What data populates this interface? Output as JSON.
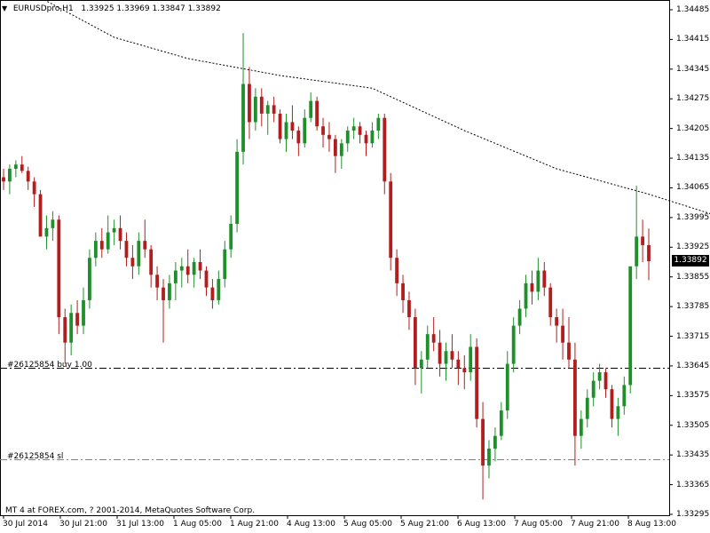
{
  "header": {
    "symbol": "EURUSDpro,H1",
    "ohlc": "1.33925 1.33969 1.33847 1.33892"
  },
  "current_price": "1.33892",
  "orders": {
    "buy_label": "#26125854 buy 1.00",
    "sl_label": "#26125854 sl"
  },
  "copyright": "MT 4 at FOREX.com, ? 2001-2014, MetaQuotes Software Corp.",
  "colors": {
    "bull": "#1f8f2a",
    "bear": "#b21e1e",
    "ma_line": "#000000",
    "buy_line": "#000000",
    "sl_line": "#e0603a",
    "background": "#ffffff",
    "current_price_bg": "#000000"
  },
  "chart_data": {
    "type": "candlestick",
    "title": "EURUSDpro,H1",
    "price_ticks": [
      "1.34485",
      "1.34415",
      "1.34345",
      "1.34275",
      "1.34205",
      "1.34135",
      "1.34065",
      "1.33995",
      "1.33925",
      "1.33855",
      "1.33785",
      "1.33715",
      "1.33645",
      "1.33575",
      "1.33505",
      "1.33435",
      "1.33365",
      "1.33295"
    ],
    "time_ticks": [
      "30 Jul 2014",
      "30 Jul 21:00",
      "31 Jul 13:00",
      "1 Aug 05:00",
      "1 Aug 21:00",
      "4 Aug 13:00",
      "5 Aug 05:00",
      "5 Aug 21:00",
      "6 Aug 13:00",
      "7 Aug 05:00",
      "7 Aug 21:00",
      "8 Aug 13:00"
    ],
    "ylim": [
      1.33295,
      1.34485
    ],
    "buy_level": 1.3364,
    "sl_level": 1.33425,
    "moving_average": [
      [
        0,
        1.3456
      ],
      [
        18,
        1.3442
      ],
      [
        30,
        1.3437
      ],
      [
        45,
        1.3433
      ],
      [
        60,
        1.343
      ],
      [
        75,
        1.342
      ],
      [
        90,
        1.3411
      ],
      [
        105,
        1.3405
      ],
      [
        117,
        1.33995
      ],
      [
        120,
        1.3398
      ]
    ],
    "candles": [
      [
        1.3409,
        1.3411,
        1.3406,
        1.3408
      ],
      [
        1.3408,
        1.3412,
        1.3405,
        1.3411
      ],
      [
        1.3411,
        1.3413,
        1.3409,
        1.3412
      ],
      [
        1.3412,
        1.3414,
        1.341,
        1.34105
      ],
      [
        1.34105,
        1.34115,
        1.3406,
        1.3408
      ],
      [
        1.3408,
        1.3409,
        1.3402,
        1.3405
      ],
      [
        1.3405,
        1.3406,
        1.3398,
        1.3395
      ],
      [
        1.3395,
        1.34,
        1.3392,
        1.3397
      ],
      [
        1.3397,
        1.3401,
        1.3394,
        1.3399
      ],
      [
        1.3399,
        1.34,
        1.3372,
        1.3376
      ],
      [
        1.3376,
        1.3378,
        1.3365,
        1.337
      ],
      [
        1.337,
        1.3379,
        1.3367,
        1.3377
      ],
      [
        1.3377,
        1.338,
        1.3372,
        1.3374
      ],
      [
        1.3374,
        1.3383,
        1.3372,
        1.338
      ],
      [
        1.338,
        1.3392,
        1.3378,
        1.339
      ],
      [
        1.339,
        1.3396,
        1.3388,
        1.3394
      ],
      [
        1.3394,
        1.3397,
        1.339,
        1.3392
      ],
      [
        1.3392,
        1.34,
        1.3391,
        1.3396
      ],
      [
        1.3396,
        1.3399,
        1.3393,
        1.3397
      ],
      [
        1.3397,
        1.34,
        1.3392,
        1.3394
      ],
      [
        1.3394,
        1.3396,
        1.3388,
        1.339
      ],
      [
        1.339,
        1.3393,
        1.3385,
        1.3388
      ],
      [
        1.3388,
        1.3396,
        1.3386,
        1.3394
      ],
      [
        1.3394,
        1.3399,
        1.339,
        1.3392
      ],
      [
        1.3392,
        1.3393,
        1.3383,
        1.3386
      ],
      [
        1.3386,
        1.3388,
        1.338,
        1.3383
      ],
      [
        1.3383,
        1.3385,
        1.337,
        1.338
      ],
      [
        1.338,
        1.3386,
        1.3378,
        1.3384
      ],
      [
        1.3384,
        1.3389,
        1.338,
        1.3387
      ],
      [
        1.3387,
        1.339,
        1.3383,
        1.3388
      ],
      [
        1.3388,
        1.3392,
        1.3384,
        1.3386
      ],
      [
        1.3386,
        1.339,
        1.3383,
        1.3389
      ],
      [
        1.3389,
        1.3392,
        1.3385,
        1.3387
      ],
      [
        1.3387,
        1.3388,
        1.3381,
        1.3383
      ],
      [
        1.3383,
        1.3385,
        1.3378,
        1.338
      ],
      [
        1.338,
        1.3387,
        1.3379,
        1.3385
      ],
      [
        1.3385,
        1.3394,
        1.3383,
        1.3392
      ],
      [
        1.3392,
        1.34,
        1.339,
        1.3398
      ],
      [
        1.3398,
        1.3418,
        1.3396,
        1.3415
      ],
      [
        1.3415,
        1.3443,
        1.3412,
        1.3431
      ],
      [
        1.3431,
        1.3435,
        1.3418,
        1.3422
      ],
      [
        1.3422,
        1.343,
        1.342,
        1.3428
      ],
      [
        1.3428,
        1.343,
        1.3421,
        1.3424
      ],
      [
        1.3424,
        1.3427,
        1.3419,
        1.3426
      ],
      [
        1.3426,
        1.3428,
        1.3422,
        1.3424
      ],
      [
        1.3424,
        1.3425,
        1.3417,
        1.3418
      ],
      [
        1.3418,
        1.3424,
        1.3415,
        1.3422
      ],
      [
        1.3422,
        1.3426,
        1.3418,
        1.342
      ],
      [
        1.342,
        1.3421,
        1.3414,
        1.3417
      ],
      [
        1.3417,
        1.3425,
        1.3416,
        1.3423
      ],
      [
        1.3423,
        1.3429,
        1.3422,
        1.3427
      ],
      [
        1.3427,
        1.3428,
        1.342,
        1.3421
      ],
      [
        1.3421,
        1.3423,
        1.3416,
        1.3419
      ],
      [
        1.3419,
        1.3422,
        1.3415,
        1.3418
      ],
      [
        1.3418,
        1.3419,
        1.341,
        1.3414
      ],
      [
        1.3414,
        1.3418,
        1.3411,
        1.3417
      ],
      [
        1.3417,
        1.3421,
        1.3415,
        1.342
      ],
      [
        1.342,
        1.3423,
        1.3418,
        1.3421
      ],
      [
        1.3421,
        1.3422,
        1.3417,
        1.3419
      ],
      [
        1.3419,
        1.342,
        1.3414,
        1.3417
      ],
      [
        1.3417,
        1.3422,
        1.3416,
        1.342
      ],
      [
        1.342,
        1.3424,
        1.3418,
        1.3423
      ],
      [
        1.3423,
        1.3424,
        1.3405,
        1.3408
      ],
      [
        1.3408,
        1.341,
        1.3387,
        1.339
      ],
      [
        1.339,
        1.3392,
        1.3381,
        1.3384
      ],
      [
        1.3384,
        1.3386,
        1.3377,
        1.338
      ],
      [
        1.338,
        1.3382,
        1.3373,
        1.3376
      ],
      [
        1.3376,
        1.3378,
        1.336,
        1.3364
      ],
      [
        1.3364,
        1.3368,
        1.3358,
        1.3366
      ],
      [
        1.3366,
        1.3374,
        1.3364,
        1.3372
      ],
      [
        1.3372,
        1.3376,
        1.3368,
        1.337
      ],
      [
        1.337,
        1.3373,
        1.3362,
        1.3365
      ],
      [
        1.3365,
        1.337,
        1.3361,
        1.3368
      ],
      [
        1.3368,
        1.3372,
        1.3364,
        1.3366
      ],
      [
        1.3366,
        1.3368,
        1.336,
        1.3364
      ],
      [
        1.3364,
        1.3367,
        1.3359,
        1.3363
      ],
      [
        1.3363,
        1.3372,
        1.3361,
        1.3369
      ],
      [
        1.3369,
        1.3371,
        1.335,
        1.3352
      ],
      [
        1.3352,
        1.3356,
        1.3333,
        1.3341
      ],
      [
        1.3341,
        1.3347,
        1.3338,
        1.3345
      ],
      [
        1.3345,
        1.335,
        1.3342,
        1.3348
      ],
      [
        1.3348,
        1.3356,
        1.3347,
        1.3354
      ],
      [
        1.3354,
        1.3368,
        1.3352,
        1.3365
      ],
      [
        1.3365,
        1.3376,
        1.3363,
        1.3374
      ],
      [
        1.3374,
        1.338,
        1.3372,
        1.3378
      ],
      [
        1.3378,
        1.3386,
        1.3376,
        1.3384
      ],
      [
        1.3384,
        1.3387,
        1.3379,
        1.3382
      ],
      [
        1.3382,
        1.339,
        1.338,
        1.3387
      ],
      [
        1.3387,
        1.3389,
        1.3381,
        1.3383
      ],
      [
        1.3383,
        1.3384,
        1.3374,
        1.3376
      ],
      [
        1.3376,
        1.3378,
        1.337,
        1.3374
      ],
      [
        1.3374,
        1.3378,
        1.3366,
        1.337
      ],
      [
        1.337,
        1.3376,
        1.3364,
        1.3366
      ],
      [
        1.3366,
        1.337,
        1.3341,
        1.3348
      ],
      [
        1.3348,
        1.3354,
        1.3345,
        1.3352
      ],
      [
        1.3352,
        1.3359,
        1.335,
        1.3357
      ],
      [
        1.3357,
        1.3363,
        1.3355,
        1.3361
      ],
      [
        1.3361,
        1.3365,
        1.3359,
        1.3363
      ],
      [
        1.3363,
        1.3364,
        1.3357,
        1.3359
      ],
      [
        1.3359,
        1.336,
        1.335,
        1.3352
      ],
      [
        1.3352,
        1.3357,
        1.3348,
        1.3355
      ],
      [
        1.3355,
        1.3362,
        1.3353,
        1.336
      ],
      [
        1.336,
        1.338,
        1.3358,
        1.3388
      ],
      [
        1.3388,
        1.3407,
        1.3385,
        1.3395
      ],
      [
        1.3395,
        1.3399,
        1.3389,
        1.3393
      ],
      [
        1.3393,
        1.33969,
        1.33847,
        1.33892
      ]
    ]
  }
}
